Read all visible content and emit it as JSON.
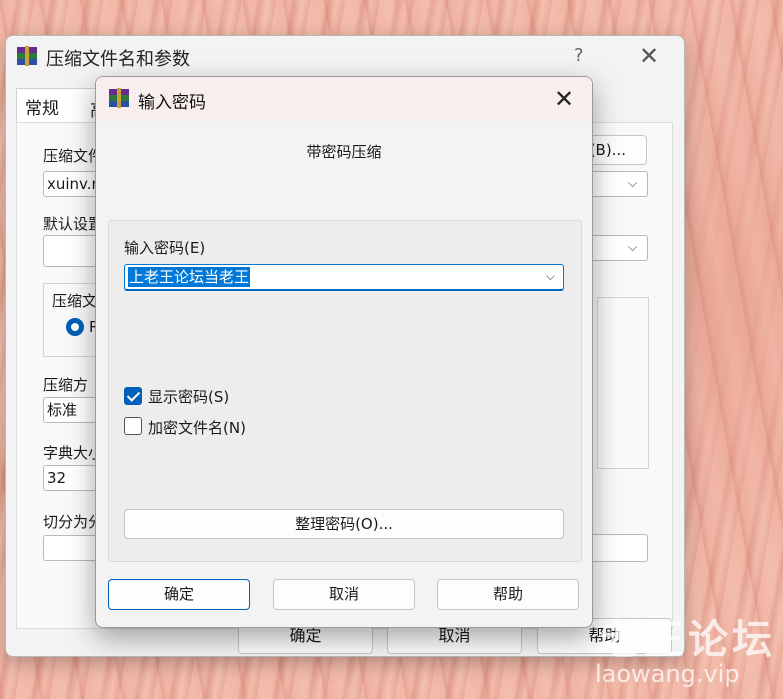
{
  "background_window": {
    "title": "压缩文件名和参数",
    "help_glyph": "?",
    "close_glyph": "✕",
    "tabs": [
      "常规",
      "高"
    ],
    "archive_name_label": "压缩文件",
    "archive_name_value": "xuinv.r",
    "browse_button": "(B)...",
    "default_settings_label": "默认设置",
    "archive_format_label": "压缩文",
    "radio_label": "R",
    "method_label": "压缩方",
    "method_value": "标准",
    "dictionary_label": "字典大小",
    "dictionary_value": "32",
    "split_label": "切分为分",
    "ok_button": "确定",
    "cancel_button": "取消",
    "help_button": "帮助"
  },
  "dialog": {
    "title": "输入密码",
    "close_glyph": "✕",
    "subtitle": "带密码压缩",
    "password_label": "输入密码(E)",
    "password_value": "上老王论坛当老王",
    "show_password_label": "显示密码(S)",
    "show_password_checked": true,
    "encrypt_names_label": "加密文件名(N)",
    "encrypt_names_checked": false,
    "organize_button": "整理密码(O)...",
    "ok_button": "确定",
    "cancel_button": "取消",
    "help_button": "帮助"
  },
  "watermark": {
    "line1": "老王论坛",
    "line2": "laowang.vip"
  },
  "colors": {
    "accent": "#005fb8",
    "selection": "#0078d7"
  }
}
